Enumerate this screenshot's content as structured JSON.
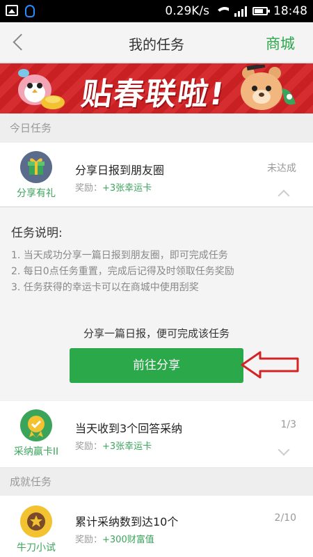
{
  "status_bar": {
    "speed": "0.29K/s",
    "time": "18:48"
  },
  "header": {
    "title": "我的任务",
    "right_action": "商城"
  },
  "banner": {
    "text": "贴春联啦!"
  },
  "sections": {
    "today": "今日任务",
    "achievement": "成就任务"
  },
  "tasks": [
    {
      "badge_label": "分享有礼",
      "title": "分享日报到朋友圈",
      "reward_prefix": "奖励：",
      "reward": "+3张幸运卡",
      "status": "未达成"
    },
    {
      "badge_label": "采纳赢卡II",
      "title": "当天收到3个回答采纳",
      "reward_prefix": "奖励：",
      "reward": "+3张幸运卡",
      "status": "1/3"
    },
    {
      "badge_label": "牛刀小试",
      "title": "累计采纳数到达10个",
      "reward_prefix": "奖励：",
      "reward": "+300财富值",
      "status": "2/10"
    }
  ],
  "description": {
    "title": "任务说明:",
    "items": [
      "1. 当天成功分享一篇日报到朋友圈，即可完成任务",
      "2. 每日0点任务重置，完成后记得及时领取任务奖励",
      "3. 任务获得的幸运卡可以在商城中使用刮奖"
    ],
    "hint": "分享一篇日报，便可完成该任务",
    "button": "前往分享"
  },
  "colors": {
    "accent_green": "#2aa84a",
    "banner_red": "#d42225"
  }
}
